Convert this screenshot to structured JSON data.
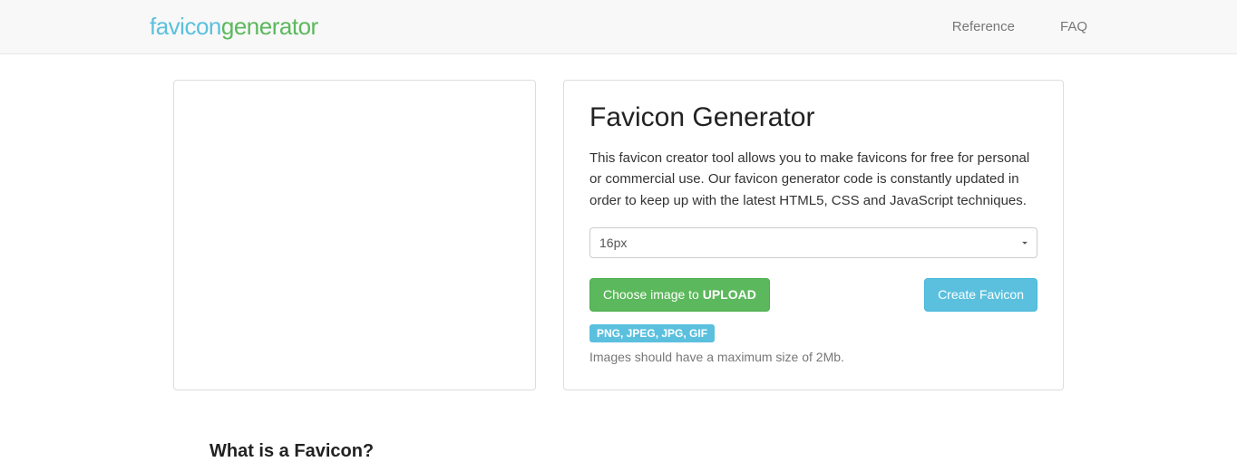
{
  "nav": {
    "brand_a": "favicon",
    "brand_b": "generator",
    "links": {
      "reference": "Reference",
      "faq": "FAQ"
    }
  },
  "main": {
    "heading": "Favicon Generator",
    "description": "This favicon creator tool allows you to make favicons for free for personal or commercial use. Our favicon generator code is constantly updated in order to keep up with the latest HTML5, CSS and JavaScript techniques.",
    "size_select": {
      "value": "16px"
    },
    "upload_button": {
      "prefix": "Choose image to ",
      "strong": "UPLOAD"
    },
    "create_button": "Create Favicon",
    "formats_badge": "PNG, JPEG, JPG, GIF",
    "size_hint": "Images should have a maximum size of 2Mb."
  },
  "section": {
    "what_is_heading": "What is a Favicon?"
  }
}
